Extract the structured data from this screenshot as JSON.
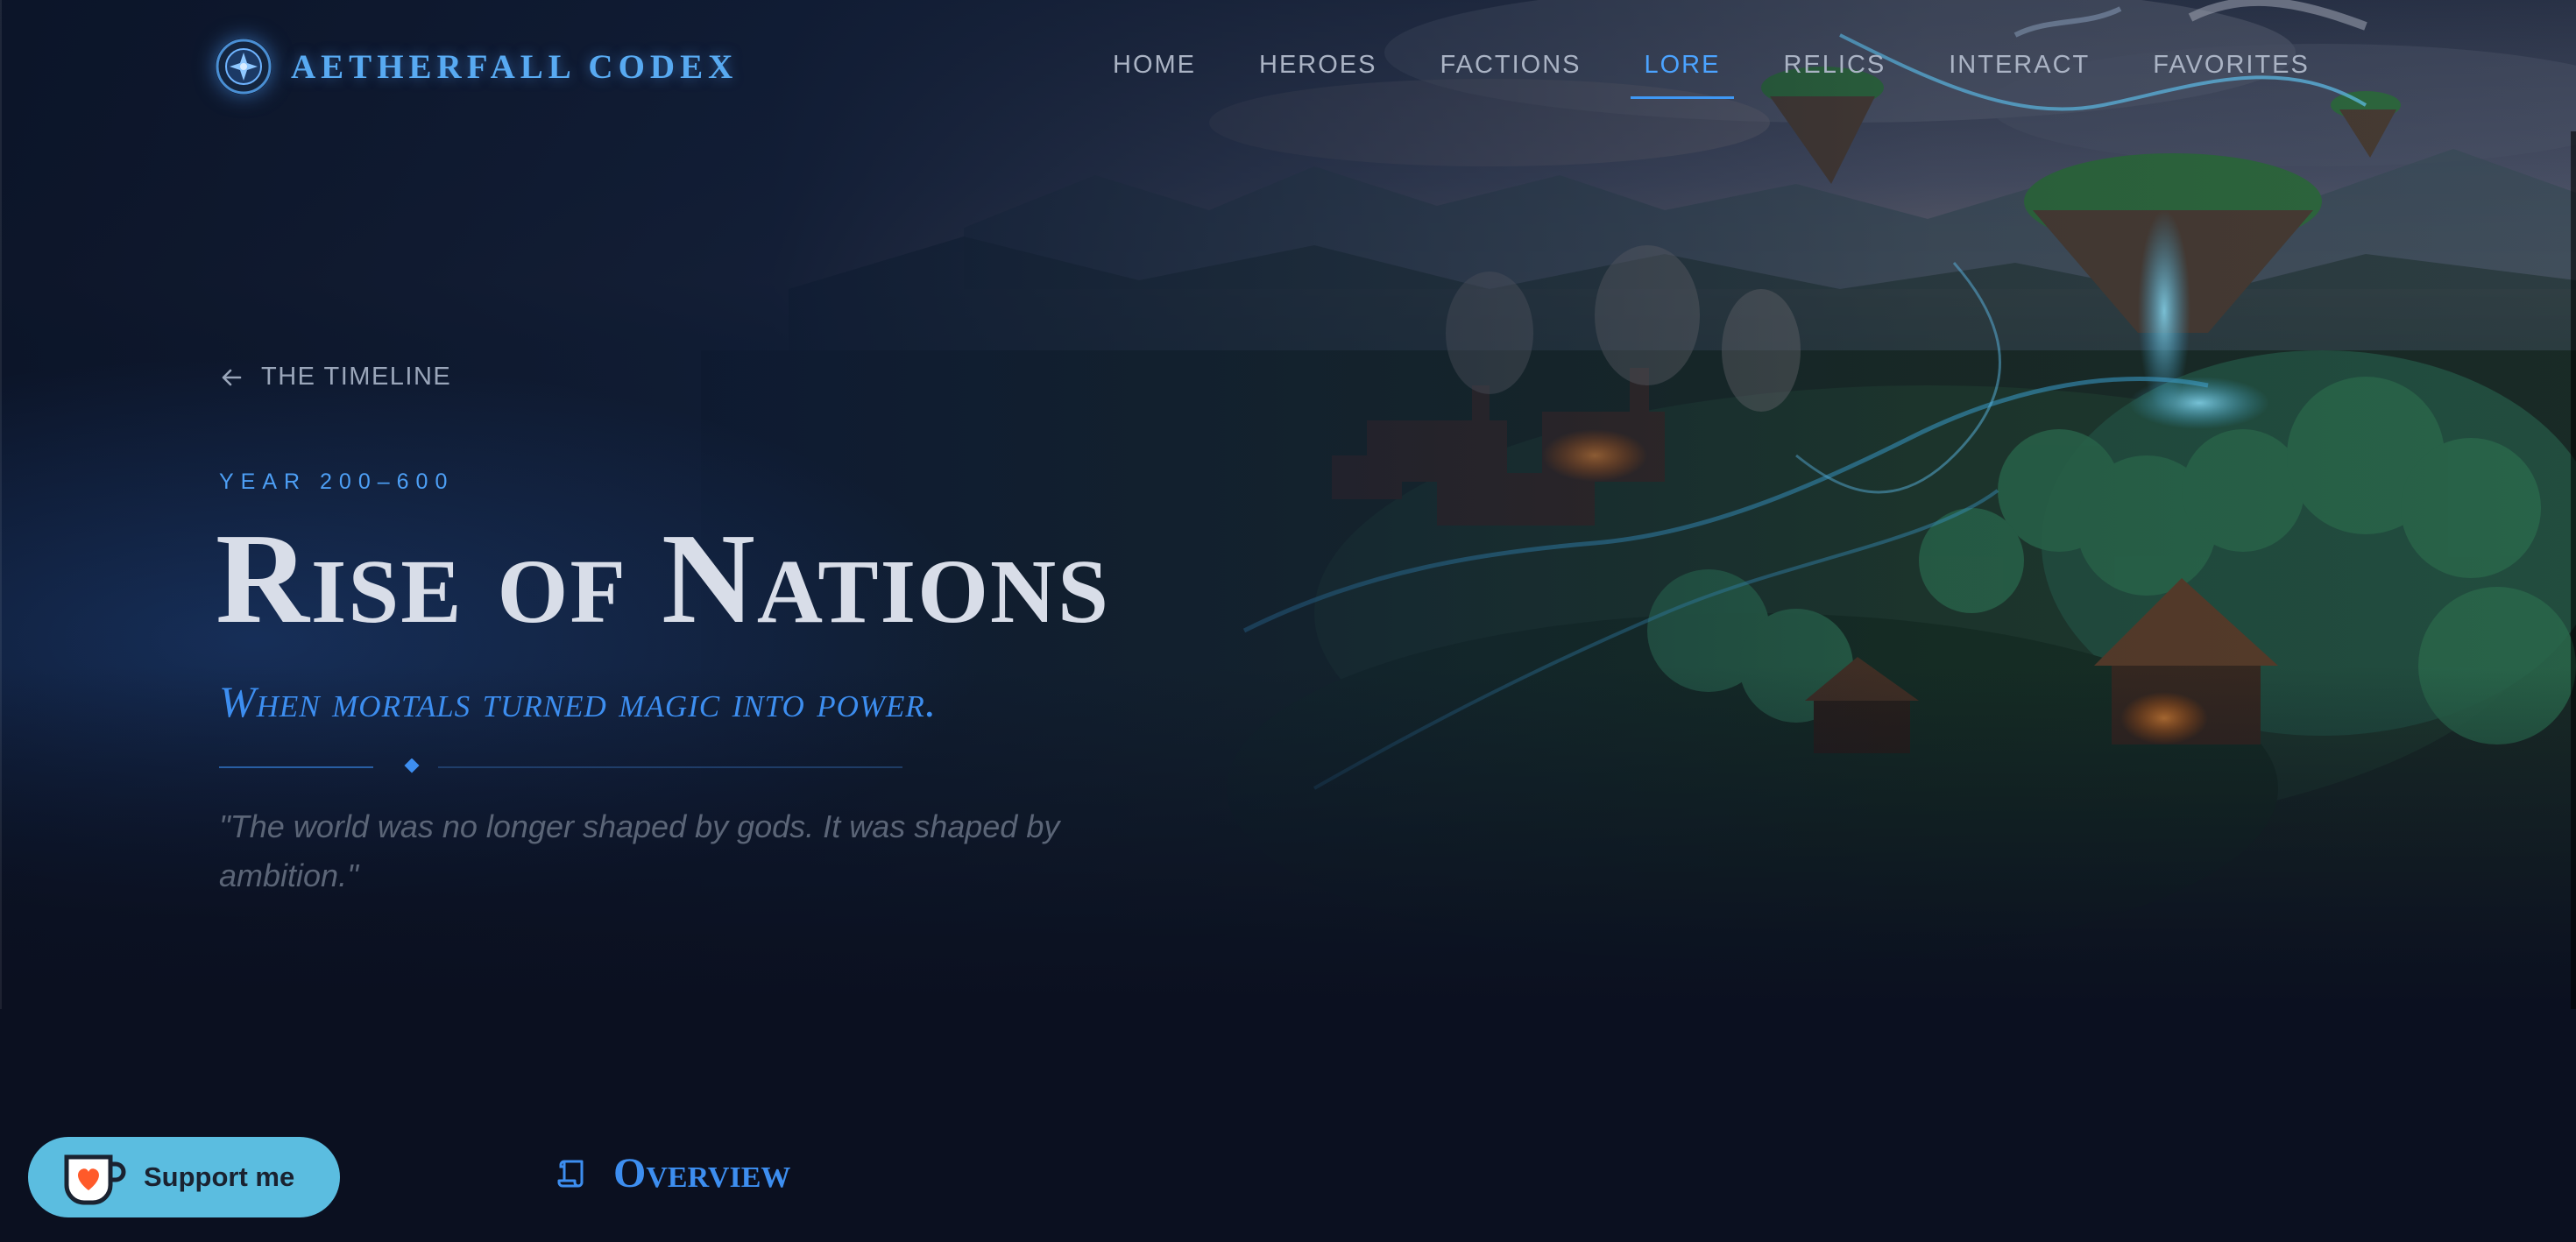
{
  "brand": {
    "name": "AETHERFALL CODEX",
    "emblem_icon": "codex-emblem-icon",
    "color": "#58aaf2"
  },
  "nav": {
    "items": [
      {
        "label": "HOME",
        "active": false
      },
      {
        "label": "HEROES",
        "active": false
      },
      {
        "label": "FACTIONS",
        "active": false
      },
      {
        "label": "LORE",
        "active": true
      },
      {
        "label": "RELICS",
        "active": false
      },
      {
        "label": "INTERACT",
        "active": false
      },
      {
        "label": "FAVORITES",
        "active": false
      }
    ],
    "active_color": "#4ba3ff"
  },
  "hero": {
    "back_link": {
      "label": "THE TIMELINE",
      "icon": "arrow-left-icon"
    },
    "era": "YEAR 200–600",
    "title": "Rise of Nations",
    "subtitle": "When mortals turned magic into power.",
    "quote": "\"The world was no longer shaped by gods. It was shaped by ambition.\"",
    "background": "fantasy-landscape-floating-island-villages"
  },
  "overview": {
    "title": "Overview",
    "icon": "scroll-icon"
  },
  "support": {
    "label": "Support me",
    "icon": "coffee-cup-heart-icon",
    "color": "#5bbde0"
  },
  "theme": {
    "background": "#0b1020",
    "accent": "#3d8ef0",
    "title_color": "#d8dde8"
  }
}
